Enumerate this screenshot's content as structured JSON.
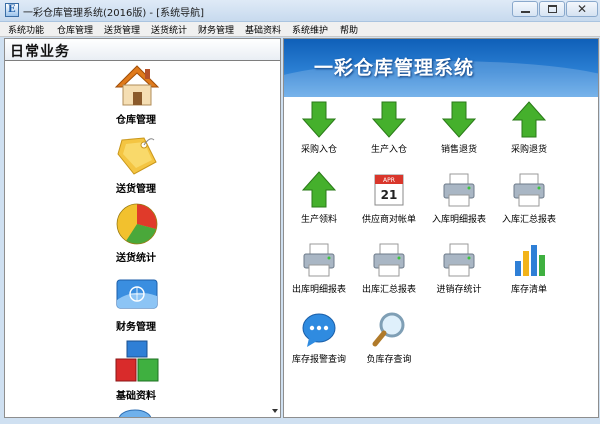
{
  "window": {
    "title": "一彩仓库管理系统(2016版) - [系统导航]",
    "app_icon_letter": "E"
  },
  "menu": [
    {
      "label": "系统功能"
    },
    {
      "label": "仓库管理"
    },
    {
      "label": "送货管理"
    },
    {
      "label": "送货统计"
    },
    {
      "label": "财务管理"
    },
    {
      "label": "基础资料"
    },
    {
      "label": "系统维护"
    },
    {
      "label": "帮助"
    }
  ],
  "sidebar": {
    "header": "日常业务",
    "items": [
      {
        "label": "仓库管理",
        "icon": "house-icon"
      },
      {
        "label": "送货管理",
        "icon": "price-tag-icon"
      },
      {
        "label": "送货统计",
        "icon": "pie-chart-icon"
      },
      {
        "label": "财务管理",
        "icon": "bank-card-icon"
      },
      {
        "label": "基础资料",
        "icon": "blocks-icon"
      }
    ]
  },
  "main": {
    "banner_title": "一彩仓库管理系统",
    "functions": [
      {
        "label": "采购入仓",
        "icon": "green-arrow-down-icon"
      },
      {
        "label": "生产入仓",
        "icon": "green-arrow-down-icon"
      },
      {
        "label": "销售退货",
        "icon": "green-arrow-down-icon"
      },
      {
        "label": "采购退货",
        "icon": "green-arrow-up-icon"
      },
      {
        "label": "生产领料",
        "icon": "green-arrow-up-icon"
      },
      {
        "label": "供应商对帐单",
        "icon": "calendar-icon"
      },
      {
        "label": "入库明细报表",
        "icon": "printer-icon"
      },
      {
        "label": "入库汇总报表",
        "icon": "printer-icon"
      },
      {
        "label": "出库明细报表",
        "icon": "printer-icon"
      },
      {
        "label": "出库汇总报表",
        "icon": "printer-icon"
      },
      {
        "label": "进销存统计",
        "icon": "printer-icon"
      },
      {
        "label": "库存清单",
        "icon": "bar-chart-icon"
      },
      {
        "label": "库存报警查询",
        "icon": "chat-bubble-icon"
      },
      {
        "label": "负库存查询",
        "icon": "magnifier-icon"
      }
    ],
    "calendar": {
      "month": "APR",
      "day": "21"
    }
  },
  "colors": {
    "arrow_green": "#3fa82a",
    "banner_blue": "#1f6fc6",
    "window_chrome": "#cfe0f1"
  }
}
